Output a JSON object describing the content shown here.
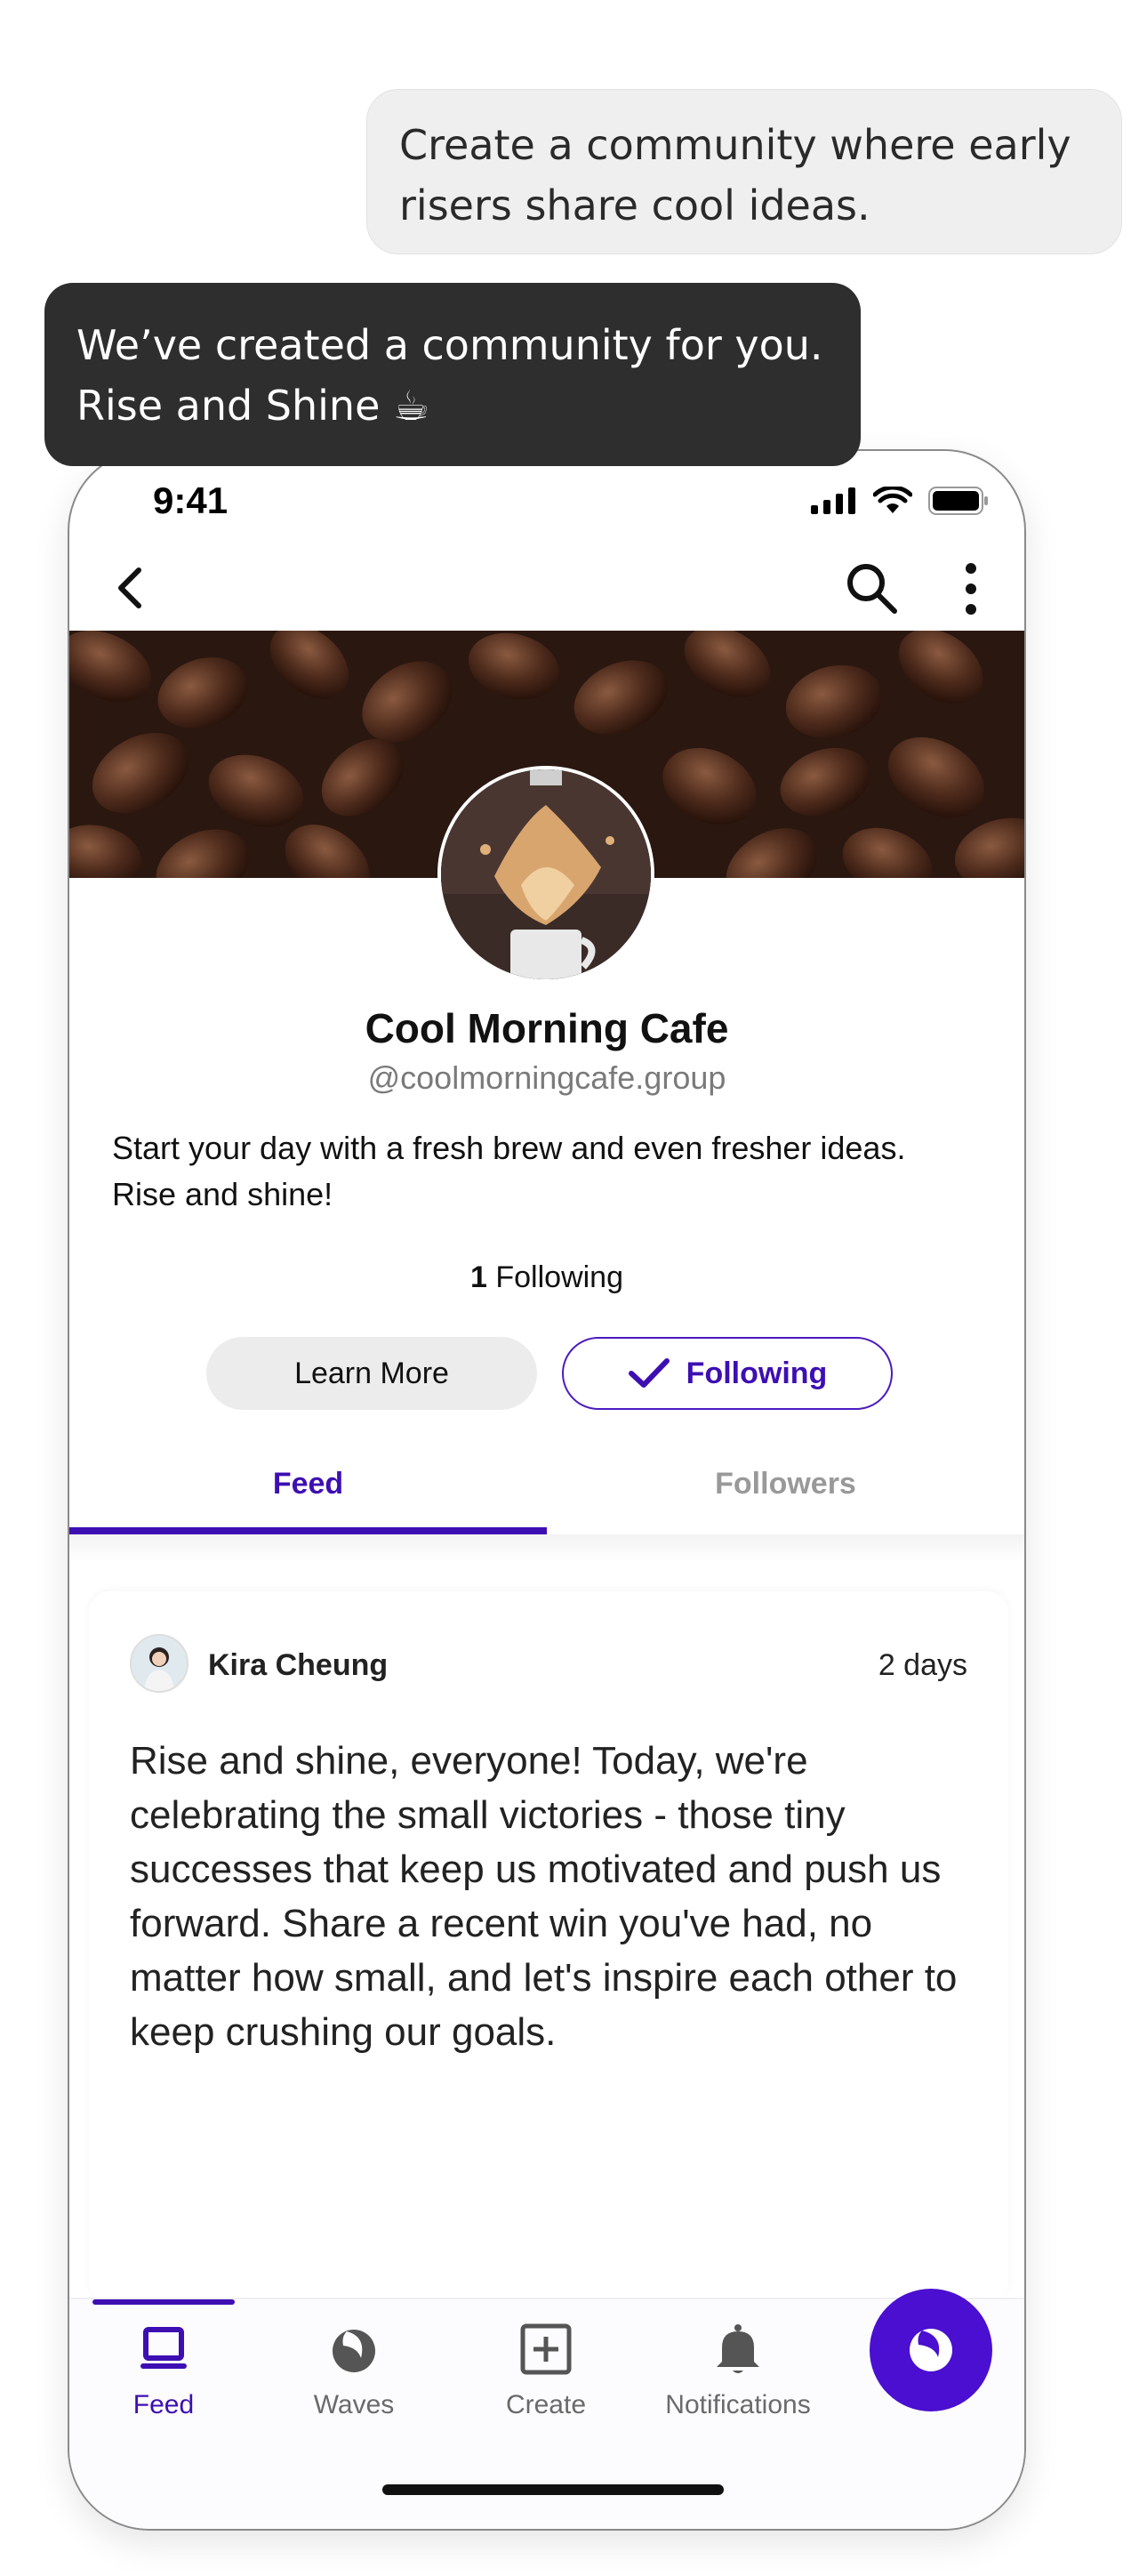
{
  "chat": {
    "user_message": "Create a community where early risers share cool ideas.",
    "bot_message": "We’ve created a community for you. Rise and Shine ☕"
  },
  "status_bar": {
    "time": "9:41"
  },
  "group": {
    "name": "Cool Morning Cafe",
    "handle": "@coolmorningcafe.group",
    "description": "Start your day with a fresh brew and even fresher ideas. Rise and shine!",
    "following_count": "1",
    "following_label": "Following"
  },
  "actions": {
    "learn_more": "Learn More",
    "following": "Following"
  },
  "tabs": [
    {
      "label": "Feed",
      "active": true
    },
    {
      "label": "Followers",
      "active": false
    }
  ],
  "post": {
    "author": "Kira Cheung",
    "time": "2 days",
    "body": "Rise and shine, everyone! Today, we're celebrating the small victories - those tiny successes that keep us motivated and push us forward. Share a recent win you've had, no matter how small, and let's inspire each other to keep crushing our goals."
  },
  "bottom_nav": [
    {
      "label": "Feed",
      "icon": "feed-icon",
      "active": true
    },
    {
      "label": "Waves",
      "icon": "waves-icon",
      "active": false
    },
    {
      "label": "Create",
      "icon": "create-icon",
      "active": false
    },
    {
      "label": "Notifications",
      "icon": "bell-icon",
      "active": false
    }
  ],
  "colors": {
    "accent": "#3d0fb3",
    "fab": "#4a0fd0",
    "bot_bubble": "#2e2e2e",
    "user_bubble": "#efefef"
  }
}
